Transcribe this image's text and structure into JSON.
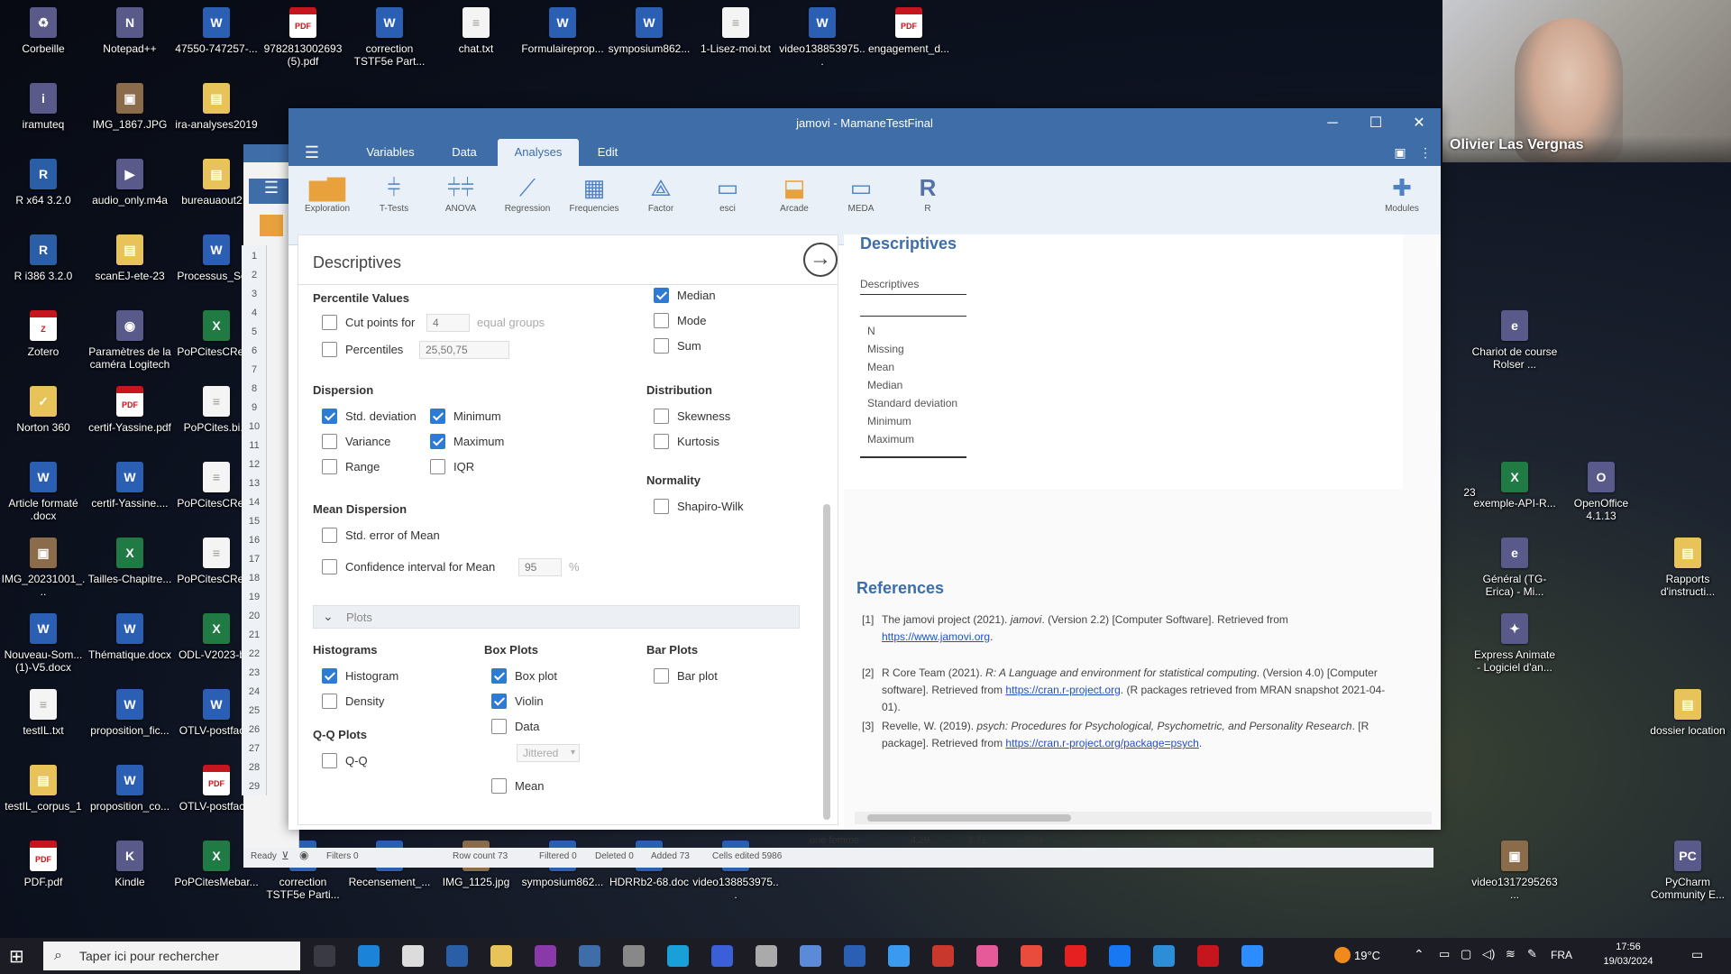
{
  "desktop_icons": [
    {
      "label": "Corbeille",
      "type": "misc",
      "glyph": "♻"
    },
    {
      "label": "Notepad++",
      "type": "misc",
      "glyph": "N"
    },
    {
      "label": "47550-747257-...",
      "type": "word",
      "glyph": "W"
    },
    {
      "label": "9782813002693 (5).pdf",
      "type": "pdf",
      "glyph": "PDF"
    },
    {
      "label": "correction TSTF5e Part...",
      "type": "word",
      "glyph": "W"
    },
    {
      "label": "chat.txt",
      "type": "txt",
      "glyph": "≡"
    },
    {
      "label": "Formulaireprop...",
      "type": "word",
      "glyph": "W"
    },
    {
      "label": "symposium862...",
      "type": "word",
      "glyph": "W"
    },
    {
      "label": "1-Lisez-moi.txt",
      "type": "txt",
      "glyph": "≡"
    },
    {
      "label": "video138853975...",
      "type": "word",
      "glyph": "W"
    },
    {
      "label": "engagement_d...",
      "type": "pdf",
      "glyph": "PDF"
    },
    {
      "label": "iramuteq",
      "type": "misc",
      "glyph": "i"
    },
    {
      "label": "IMG_1867.JPG",
      "type": "img",
      "glyph": "▣"
    },
    {
      "label": "ira-analyses2019",
      "type": "fold",
      "glyph": "▤"
    },
    {
      "label": "R x64 3.2.0",
      "type": "r",
      "glyph": "R"
    },
    {
      "label": "audio_only.m4a",
      "type": "misc",
      "glyph": "▶"
    },
    {
      "label": "bureauaout2...",
      "type": "fold",
      "glyph": "▤"
    },
    {
      "label": "R i386 3.2.0",
      "type": "r",
      "glyph": "R"
    },
    {
      "label": "scanEJ-ete-23",
      "type": "fold",
      "glyph": "▤"
    },
    {
      "label": "Processus_So...",
      "type": "word",
      "glyph": "W"
    },
    {
      "label": "Zotero",
      "type": "pdf",
      "glyph": "Z"
    },
    {
      "label": "Paramètres de la caméra Logitech",
      "type": "misc",
      "glyph": "◉"
    },
    {
      "label": "PoPCitesCRef...",
      "type": "xls",
      "glyph": "X"
    },
    {
      "label": "Norton 360",
      "type": "fold",
      "glyph": "✓"
    },
    {
      "label": "certif-Yassine.pdf",
      "type": "pdf",
      "glyph": "PDF"
    },
    {
      "label": "PoPCites.bi...",
      "type": "txt",
      "glyph": "≡"
    },
    {
      "label": "Article formaté .docx",
      "type": "word",
      "glyph": "W"
    },
    {
      "label": "certif-Yassine....",
      "type": "word",
      "glyph": "W"
    },
    {
      "label": "PoPCitesCRef...",
      "type": "txt",
      "glyph": "≡"
    },
    {
      "label": "IMG_20231001_...",
      "type": "img",
      "glyph": "▣"
    },
    {
      "label": "Tailles-Chapitre...",
      "type": "xls",
      "glyph": "X"
    },
    {
      "label": "PoPCitesCRef...",
      "type": "txt",
      "glyph": "≡"
    },
    {
      "label": "Nouveau-Som... (1)-V5.docx",
      "type": "word",
      "glyph": "W"
    },
    {
      "label": "Thématique.docx",
      "type": "word",
      "glyph": "W"
    },
    {
      "label": "ODL-V2023-b...",
      "type": "xls",
      "glyph": "X"
    },
    {
      "label": "testIL.txt",
      "type": "txt",
      "glyph": "≡"
    },
    {
      "label": "proposition_fic...",
      "type": "word",
      "glyph": "W"
    },
    {
      "label": "OTLV-postfac...",
      "type": "word",
      "glyph": "W"
    },
    {
      "label": "testIL_corpus_1",
      "type": "fold",
      "glyph": "▤"
    },
    {
      "label": "proposition_co...",
      "type": "word",
      "glyph": "W"
    },
    {
      "label": "OTLV-postfac...",
      "type": "pdf",
      "glyph": "PDF"
    },
    {
      "label": "PDF.pdf",
      "type": "pdf",
      "glyph": "PDF"
    },
    {
      "label": "Kindle",
      "type": "misc",
      "glyph": "K"
    },
    {
      "label": "PoPCitesMebar...",
      "type": "xls",
      "glyph": "X"
    },
    {
      "label": "correction TSTF5e Parti...",
      "type": "word",
      "glyph": "W"
    },
    {
      "label": "Recensement_...",
      "type": "word",
      "glyph": "W"
    },
    {
      "label": "IMG_1125.jpg",
      "type": "img",
      "glyph": "▣"
    },
    {
      "label": "symposium862...",
      "type": "word",
      "glyph": "W"
    },
    {
      "label": "HDRRb2-68.doc",
      "type": "word",
      "glyph": "W"
    },
    {
      "label": "video138853975...",
      "type": "word",
      "glyph": "W"
    },
    {
      "label": "Chariot de course Rolser ...",
      "type": "misc",
      "glyph": "e"
    },
    {
      "label": "exemple-API-R...",
      "type": "xls",
      "glyph": "X"
    },
    {
      "label": "OpenOffice 4.1.13",
      "type": "misc",
      "glyph": "O"
    },
    {
      "label": "Général (TG-Erica) - Mi...",
      "type": "misc",
      "glyph": "e"
    },
    {
      "label": "Rapports d'instructi...",
      "type": "fold",
      "glyph": "▤"
    },
    {
      "label": "Express Animate - Logiciel d'an...",
      "type": "misc",
      "glyph": "✦"
    },
    {
      "label": "dossier location",
      "type": "fold",
      "glyph": "▤"
    },
    {
      "label": "video1317295263...",
      "type": "img",
      "glyph": "▣"
    },
    {
      "label": "PyCharm Community E...",
      "type": "misc",
      "glyph": "PC"
    },
    {
      "label": "23",
      "type": "none",
      "glyph": ""
    }
  ],
  "window": {
    "title": "jamovi - MamaneTestFinal",
    "minimize": "─",
    "maximize": "☐",
    "close": "✕"
  },
  "menu": {
    "hamburger": "☰",
    "tabs": [
      "Variables",
      "Data",
      "Analyses",
      "Edit"
    ],
    "active": "Analyses"
  },
  "toolbar": {
    "items": [
      "Exploration",
      "T-Tests",
      "ANOVA",
      "Regression",
      "Frequencies",
      "Factor",
      "esci",
      "Arcade",
      "MEDA",
      "R"
    ],
    "modules": "Modules"
  },
  "row_numbers": [
    "1",
    "2",
    "3",
    "4",
    "5",
    "6",
    "7",
    "8",
    "9",
    "10",
    "11",
    "12",
    "13",
    "14",
    "15",
    "16",
    "17",
    "18",
    "19",
    "20",
    "21",
    "22",
    "23",
    "24",
    "25",
    "26",
    "27",
    "28",
    "29"
  ],
  "options": {
    "title": "Descriptives",
    "percentile_values": "Percentile Values",
    "cut_points": "Cut points for",
    "cut_points_value": "4",
    "equal_groups": "equal groups",
    "percentiles": "Percentiles",
    "percentiles_value": "25,50,75",
    "median": "Median",
    "mode": "Mode",
    "sum": "Sum",
    "dispersion": "Dispersion",
    "std_deviation": "Std. deviation",
    "minimum": "Minimum",
    "variance": "Variance",
    "maximum": "Maximum",
    "range": "Range",
    "iqr": "IQR",
    "distribution": "Distribution",
    "skewness": "Skewness",
    "kurtosis": "Kurtosis",
    "normality": "Normality",
    "shapiro": "Shapiro-Wilk",
    "mean_dispersion": "Mean Dispersion",
    "std_error": "Std. error of Mean",
    "ci_mean": "Confidence interval for Mean",
    "ci_value": "95",
    "ci_unit": "%",
    "plots": "Plots",
    "histograms": "Histograms",
    "histogram": "Histogram",
    "density": "Density",
    "box_plots": "Box Plots",
    "box_plot": "Box plot",
    "violin": "Violin",
    "data": "Data",
    "jittered": "Jittered",
    "mean": "Mean",
    "bar_plots": "Bar Plots",
    "bar_plot": "Bar plot",
    "qq_plots": "Q-Q Plots",
    "qq": "Q-Q",
    "checked": {
      "median": true,
      "mode": false,
      "sum": false,
      "std_deviation": true,
      "minimum": true,
      "variance": false,
      "maximum": true,
      "range": false,
      "iqr": false,
      "skewness": false,
      "kurtosis": false,
      "shapiro": false,
      "std_error": false,
      "ci_mean": false,
      "cut_points": false,
      "percentiles": false,
      "histogram": true,
      "density": false,
      "box_plot": true,
      "violin": true,
      "data": false,
      "mean": false,
      "bar_plot": false,
      "qq": false
    }
  },
  "results": {
    "heading": "Descriptives",
    "table_title": "Descriptives",
    "rows": [
      "N",
      "Missing",
      "Mean",
      "Median",
      "Standard deviation",
      "Minimum",
      "Maximum"
    ],
    "references_heading": "References",
    "refs": [
      {
        "num": "[1]",
        "text1": "The jamovi project (2021). ",
        "ital1": "jamovi",
        "text2": ". (Version 2.2) [Computer Software]. Retrieved from",
        "link": "https://www.jamovi.org",
        "tail": "."
      },
      {
        "num": "[2]",
        "text1": "R Core Team (2021). ",
        "ital1": "R: A Language and environment for statistical computing",
        "text2": ". (Version 4.0) [Computer software]. Retrieved from ",
        "link": "https://cran.r-project.org",
        "tail": ". (R packages retrieved from MRAN snapshot 2021-04-01)."
      },
      {
        "num": "[3]",
        "text1": "Revelle, W. (2019). ",
        "ital1": "psych: Procedures for Psychological, Psychometric, and Personality Research",
        "text2": ". [R package]. Retrieved from ",
        "link": "https://cran.r-project.org/package=psych",
        "tail": "."
      }
    ]
  },
  "status": {
    "ready": "Ready",
    "filters": "Filters 0",
    "row_count": "Row count 73",
    "filtered": "Filtered 0",
    "deleted": "Deleted 0",
    "added": "Added 73",
    "cells_edited": "Cells edited 5986"
  },
  "spreadsheet_row": {
    "label": "une femme",
    "values": [
      "4.29",
      "3.71",
      "3.94",
      "3.89",
      "3.32",
      "3.15",
      "2.2€"
    ]
  },
  "webcam": {
    "name": "Olivier Las Vergnas"
  },
  "taskbar": {
    "search_placeholder": "Taper ici pour rechercher",
    "weather": "19°C",
    "lang": "FRA",
    "time": "17:56",
    "date": "19/03/2024"
  }
}
